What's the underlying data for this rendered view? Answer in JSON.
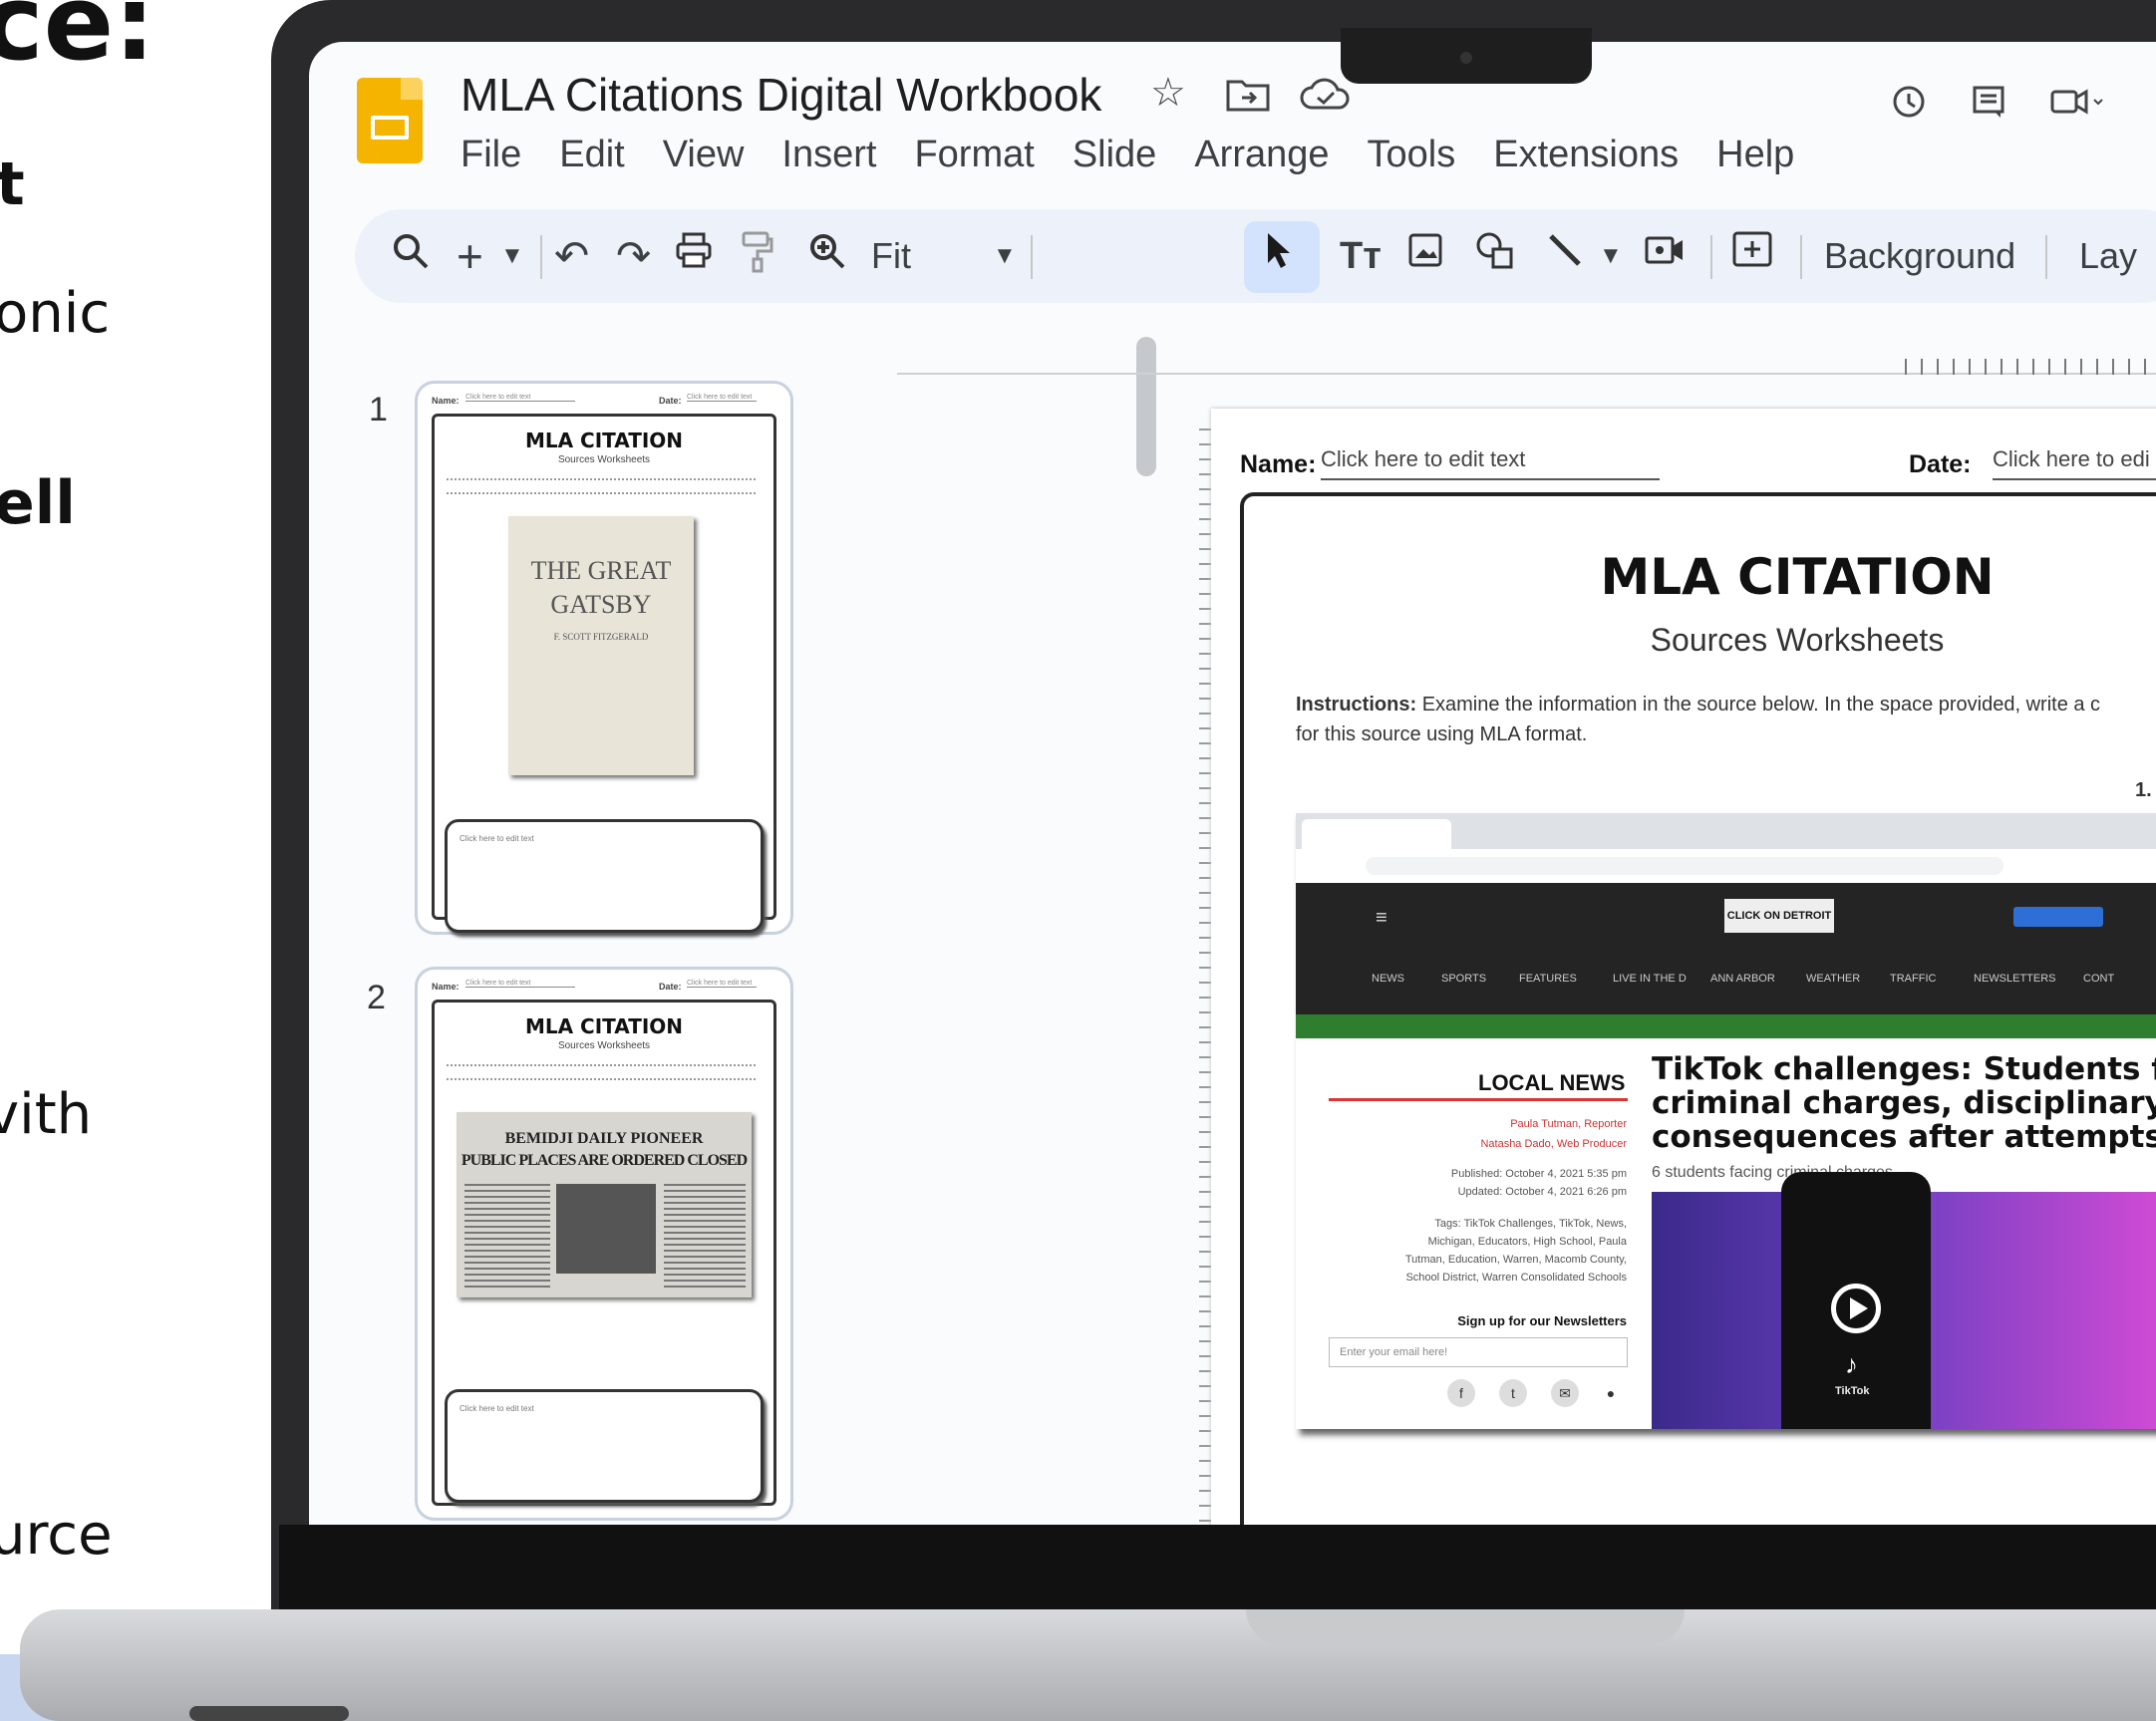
{
  "promo": {
    "fragments": [
      "ce:",
      "t",
      "onic",
      "ell",
      "vith",
      "urce"
    ]
  },
  "app": {
    "title": "MLA Citations Digital Workbook",
    "menu": [
      "File",
      "Edit",
      "View",
      "Insert",
      "Format",
      "Slide",
      "Arrange",
      "Tools",
      "Extensions",
      "Help"
    ],
    "toolbar": {
      "zoom_label": "Fit",
      "background_label": "Background",
      "layout_label": "Lay"
    }
  },
  "filmstrip": {
    "slides": [
      {
        "number": "1",
        "name_label": "Name:",
        "date_label": "Date:",
        "placeholder": "Click here to edit text",
        "title": "MLA CITATION",
        "subtitle": "Sources Worksheets",
        "book_title_1": "THE GREAT",
        "book_title_2": "GATSBY",
        "book_author": "F. SCOTT FITZGERALD"
      },
      {
        "number": "2",
        "name_label": "Name:",
        "date_label": "Date:",
        "placeholder": "Click here to edit text",
        "title": "MLA CITATION",
        "subtitle": "Sources Worksheets",
        "paper_name": "BEMIDJI  DAILY  PIONEER",
        "paper_headline": "PUBLIC PLACES ARE ORDERED CLOSED"
      }
    ]
  },
  "slide": {
    "name_label": "Name:",
    "name_value": "Click here to edit text",
    "date_label": "Date:",
    "date_value": "Click here to edi",
    "title": "MLA CITATION",
    "subtitle": "Sources Worksheets",
    "instructions_label": "Instructions:",
    "instructions_line1": "Examine the information in the source below. In the space provided, write a c",
    "instructions_line2": "for this source using MLA format.",
    "item_number": "1.",
    "source": {
      "brand": "CLICK ON DETROIT",
      "nav": [
        "NEWS",
        "SPORTS",
        "FEATURES",
        "LIVE IN THE D",
        "ANN ARBOR",
        "WEATHER",
        "TRAFFIC",
        "NEWSLETTERS",
        "CONT"
      ],
      "section": "LOCAL NEWS",
      "author1": "Paula Tutman, Reporter",
      "author2": "Natasha Dado, Web Producer",
      "published": "Published: October 4, 2021 5:35 pm",
      "updated": "Updated: October 4, 2021 6:26 pm",
      "tags_1": "Tags: TikTok Challenges, TikTok, News,",
      "tags_2": "Michigan, Educators, High School, Paula",
      "tags_3": "Tutman, Education, Warren, Macomb County,",
      "tags_4": "School District, Warren Consolidated Schools",
      "newsletter": "Sign up for our Newsletters",
      "email_placeholder": "Enter your email here!",
      "headline_1": "TikTok challenges: Students fac",
      "headline_2": "criminal charges, disciplinary",
      "headline_3": "consequences after attempts",
      "subhead": "6 students facing criminal charges",
      "tiktok_label": "TikTok"
    }
  }
}
